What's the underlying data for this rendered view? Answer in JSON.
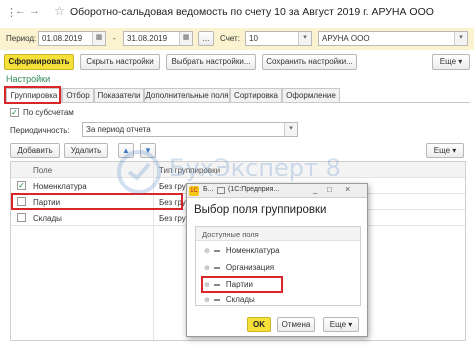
{
  "window": {
    "title": "Оборотно-сальдовая ведомость по счету 10 за Август 2019 г. АРУНА ООО",
    "more_icon": "more-vert-icon",
    "link_icon": "link-icon",
    "star_icon": "star-icon"
  },
  "filters": {
    "period_label": "Период:",
    "period_from": "01.08.2019",
    "dash": "-",
    "period_to": "31.08.2019",
    "dots": "...",
    "account_label": "Счет:",
    "account_value": "10",
    "org_value": "АРУНА ООО"
  },
  "toolbar": {
    "generate": "Сформировать",
    "hide_settings": "Скрыть настройки",
    "choose_settings": "Выбрать настройки...",
    "save_settings": "Сохранить настройки...",
    "more": "Еще"
  },
  "settings": {
    "heading": "Настройки",
    "tabs": [
      "Группировка",
      "Отбор",
      "Показатели",
      "Дополнительные поля",
      "Сортировка",
      "Оформление"
    ],
    "by_subaccounts": "По субсчетам",
    "periodicity_label": "Периодичность:",
    "periodicity_value": "За период отчета",
    "add": "Добавить",
    "delete": "Удалить",
    "more": "Еще",
    "columns": [
      "Поле",
      "Тип группировки"
    ],
    "rows": [
      {
        "field": "Номенклатура",
        "type": "Без группировки",
        "checked": true
      },
      {
        "field": "Партии",
        "type": "Без группировки",
        "checked": false
      },
      {
        "field": "Склады",
        "type": "Без группировки",
        "checked": false
      }
    ]
  },
  "watermark": {
    "text": "БухЭксперт 8"
  },
  "dialog": {
    "tab_short": "Б...",
    "tab_title": "(1С:Предприя...",
    "title": "Выбор поля группировки",
    "list_header": "Доступные поля",
    "items": [
      "Номенклатура",
      "Организация",
      "Партии",
      "Склады"
    ],
    "ok": "OK",
    "cancel": "Отмена",
    "more": "Еще"
  },
  "colors": {
    "accent_yellow": "#f5e03a",
    "highlight_red": "#d8262b",
    "settings_green": "#2e8b57",
    "filter_bar": "#fbf3d0"
  }
}
